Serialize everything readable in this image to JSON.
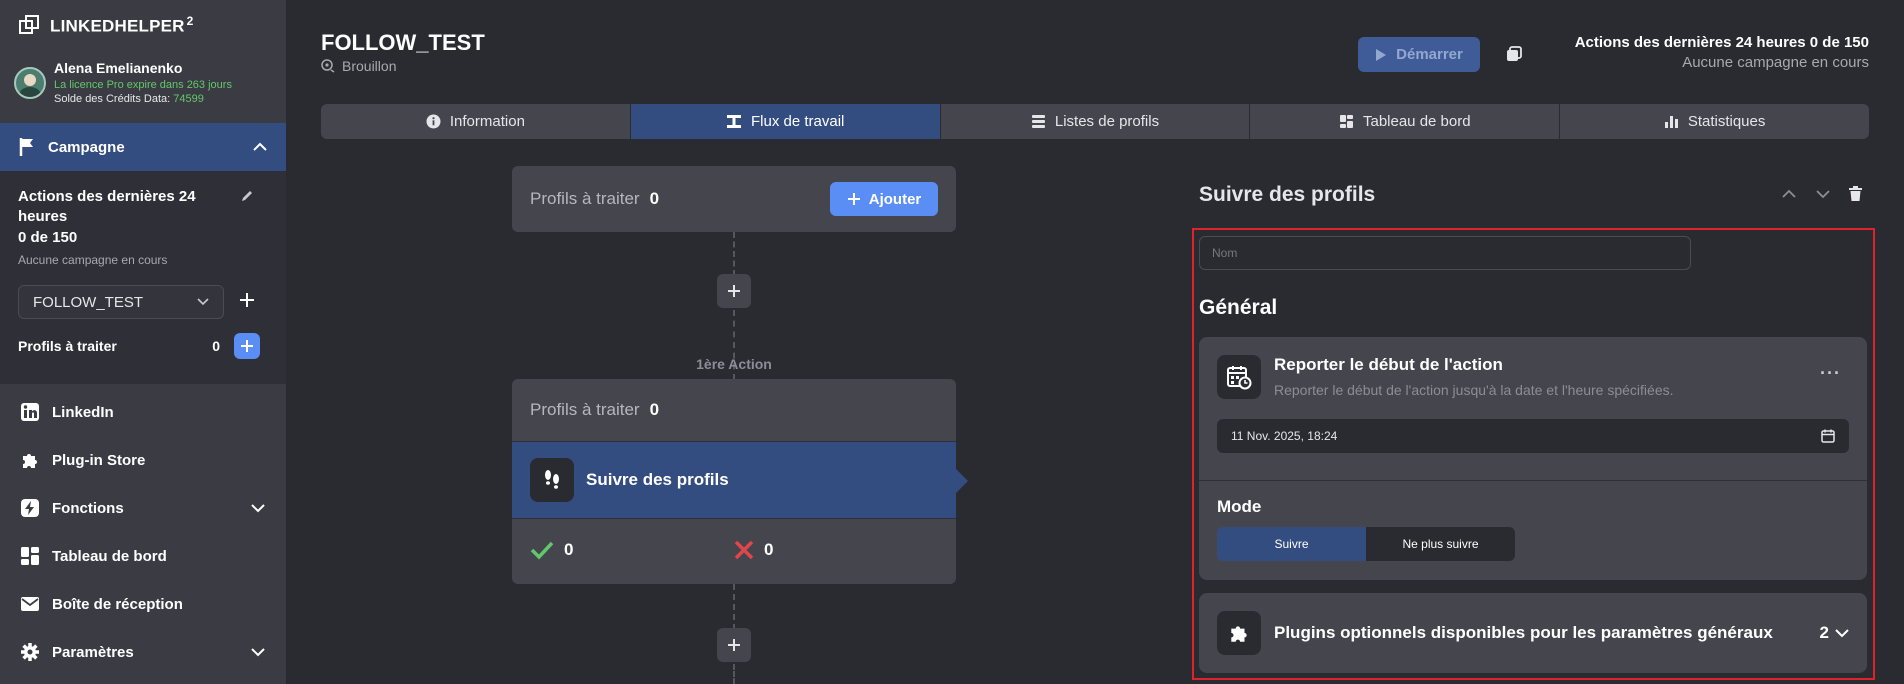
{
  "brand": {
    "name": "LINKEDHELPER",
    "sup": "2"
  },
  "user": {
    "name": "Alena Emelianenko",
    "license": "La licence Pro expire dans 263 jours",
    "credits_label": "Solde des Crédits Data:",
    "credits_value": "74599"
  },
  "sidebar": {
    "campaign_label": "Campagne",
    "actions_title": "Actions des dernières 24 heures",
    "actions_count": "0 de 150",
    "actions_sub": "Aucune campagne en cours",
    "campaign_select": "FOLLOW_TEST",
    "profiles_label": "Profils à traiter",
    "profiles_count": "0",
    "nav": [
      {
        "label": "LinkedIn",
        "icon": "linkedin-icon"
      },
      {
        "label": "Plug-in Store",
        "icon": "puzzle-icon"
      },
      {
        "label": "Fonctions",
        "icon": "bolt-icon"
      },
      {
        "label": "Tableau de bord",
        "icon": "dashboard-icon"
      },
      {
        "label": "Boîte de réception",
        "icon": "mail-icon"
      },
      {
        "label": "Paramètres",
        "icon": "gear-icon"
      }
    ]
  },
  "header": {
    "title": "FOLLOW_TEST",
    "status": "Brouillon",
    "start_label": "Démarrer",
    "stats_line1": "Actions des dernières 24 heures 0 de 150",
    "stats_line2": "Aucune campagne en cours"
  },
  "tabs": [
    {
      "label": "Information",
      "icon": "info-icon"
    },
    {
      "label": "Flux de travail",
      "icon": "workflow-icon"
    },
    {
      "label": "Listes de profils",
      "icon": "list-icon"
    },
    {
      "label": "Tableau de bord",
      "icon": "dashboard-icon"
    },
    {
      "label": "Statistiques",
      "icon": "bar-chart-icon"
    }
  ],
  "flow": {
    "queue_label": "Profils à traiter",
    "queue_count": "0",
    "add_label": "Ajouter",
    "step_label": "1ère Action",
    "step_queue_label": "Profils à traiter",
    "step_queue_count": "0",
    "action_label": "Suivre des profils",
    "success_count": "0",
    "fail_count": "0"
  },
  "panel": {
    "title": "Suivre des profils",
    "name_placeholder": "Nom",
    "general_title": "Général",
    "delay_title": "Reporter le début de l'action",
    "delay_desc": "Reporter le début de l'action jusqu'à la date et l'heure spécifiées.",
    "date_value": "11 Nov. 2025, 18:24",
    "mode_label": "Mode",
    "mode_options": [
      "Suivre",
      "Ne plus suivre"
    ],
    "mode_selected": "Suivre",
    "plugins_label": "Plugins optionnels disponibles pour les paramètres généraux",
    "plugins_count": "2"
  },
  "colors": {
    "accent": "#344d80",
    "button_blue": "#5b8ef4",
    "success": "#63c76a",
    "danger": "#e0464a",
    "highlight_border": "#e0232b"
  }
}
